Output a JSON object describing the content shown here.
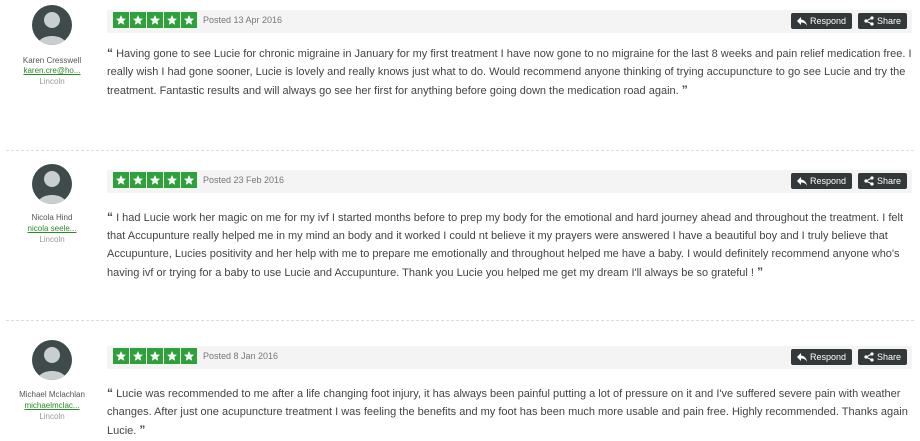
{
  "reviews": [
    {
      "name": "Karen Cresswell",
      "email": "karen.cre@ho...",
      "location": "Lincoln",
      "posted": "Posted 13 Apr 2016",
      "rating": 5,
      "text": "Having gone to see Lucie for chronic migraine in January for my first treatment I have now gone to no migraine for the last 8 weeks and pain relief medication free. I really wish I had gone sooner, Lucie is lovely and really knows just what to do. Would recommend anyone thinking of trying accupuncture to go see Lucie and try the treatment. Fantastic results and will always go see her first for anything before going down the medication road again."
    },
    {
      "name": "Nicola Hind",
      "email": "nicola seele...",
      "location": "Lincoln",
      "posted": "Posted 23 Feb 2016",
      "rating": 5,
      "text": "I had Lucie work her magic on me for my ivf I started months before to prep my body for the emotional and hard journey ahead and throughout the treatment. I felt that Accupunture really helped me in my mind an body and it worked I could nt believe it my prayers were answered I have a beautiful boy and I truly believe that Accupunture, Lucies positivity and her help with me to prepare me emotionally and throughout helped me have a baby. I would definitely recommend anyone who's having ivf or trying for a baby to use Lucie and Accupunture. Thank you Lucie you helped me get my dream I'll always be so grateful !"
    },
    {
      "name": "Michael Mclachlan",
      "email": "michaelmclac...",
      "location": "Lincoln",
      "posted": "Posted 8 Jan 2016",
      "rating": 5,
      "text": "Lucie was recommended to me after a life changing foot injury, it has always been painful putting a lot of pressure on it and I've suffered severe pain with weather changes. After just one acupuncture treatment I was feeling the benefits and my foot has been much more usable and pain free. Highly recommended. Thanks again Lucie."
    }
  ],
  "buttons": {
    "respond": "Respond",
    "share": "Share"
  },
  "quotes": {
    "open": "“",
    "close": "”"
  },
  "icons": {
    "avatar": "user-avatar-icon",
    "star": "star-icon",
    "respond": "reply-arrow-icon",
    "share": "share-icon"
  },
  "colors": {
    "star_bg": "#2fa13a",
    "button_bg": "#33393a",
    "email_link": "#2a8a2a"
  }
}
